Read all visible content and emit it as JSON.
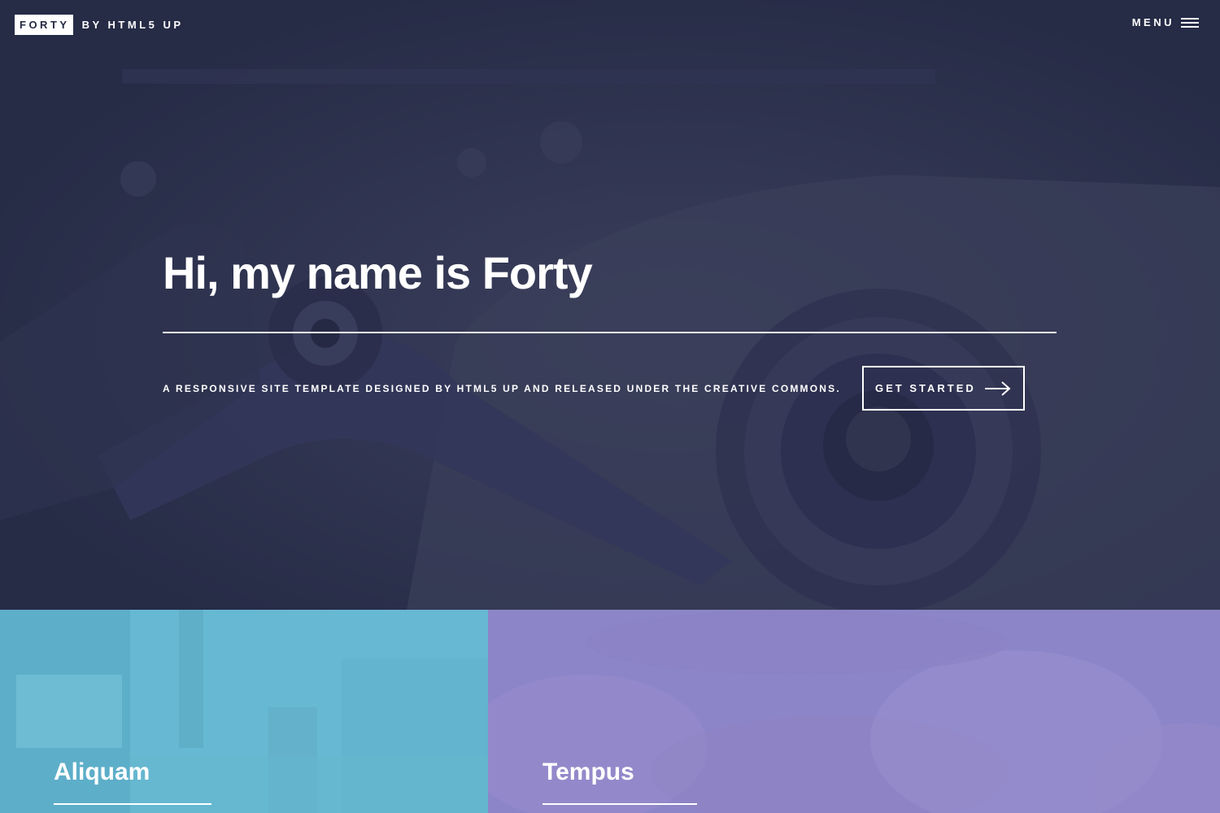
{
  "header": {
    "logo_box": "FORTY",
    "logo_rest": "BY HTML5 UP",
    "menu_label": "MENU"
  },
  "banner": {
    "title": "Hi, my name is Forty",
    "tagline": "A RESPONSIVE SITE TEMPLATE DESIGNED BY HTML5 UP AND RELEASED UNDER THE CREATIVE COMMONS.",
    "button_label": "GET STARTED",
    "overlay_color": "#242943"
  },
  "tiles": [
    {
      "title": "Aliquam",
      "color": "#6fc3df"
    },
    {
      "title": "Tempus",
      "color": "#8d82c4"
    }
  ],
  "icons": {
    "menu": "hamburger-icon",
    "button": "arrow-right-icon"
  }
}
